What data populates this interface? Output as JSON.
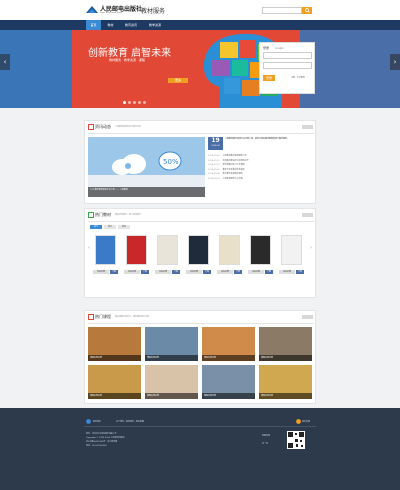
{
  "header": {
    "logo_cn": "人民邮电出版社",
    "logo_en": "Posts & Telecom Press",
    "site_name": "教材服务",
    "search_placeholder": ""
  },
  "nav": {
    "items": [
      "首页",
      "教材",
      "教育资讯",
      "教学资源"
    ]
  },
  "banner": {
    "title": "创新教育 启智未来",
    "subtitle": "教材服务 · 教学资源 · 课程",
    "button": "更多",
    "slide_count": 5,
    "active_slide": 1
  },
  "login": {
    "title": "登录",
    "hint": "/Login",
    "login_button": "登录",
    "register": "注册 · 忘记密码"
  },
  "news": {
    "title": "资讯动态",
    "subtitle": "人邮教育最新资讯与教学动态",
    "date_day": "19",
    "date_month": "2014-09",
    "caption": "TOP 教师课程资源平台上线  —— 人邮教育",
    "lead": "人邮教育教学资源平台全新上线，提供丰富的教材配套资源与教学服务。",
    "items": [
      {
        "date": "2014-09-16",
        "text": "人邮教育教材资源更新公告"
      },
      {
        "date": "2014-09-15",
        "text": "高校教材建设研讨会顺利召开"
      },
      {
        "date": "2014-09-12",
        "text": "新学期教材征订工作通知"
      },
      {
        "date": "2014-09-10",
        "text": "教师节优秀教材作者表彰"
      },
      {
        "date": "2014-09-08",
        "text": "数字教学资源使用指南"
      },
      {
        "date": "2014-09-05",
        "text": "人邮教育服务中心开通"
      }
    ]
  },
  "books": {
    "title": "热门教材",
    "subtitle": "精选优质教材，助力高效教学",
    "tabs": [
      "热门",
      "新书",
      "推荐"
    ],
    "items": [
      {
        "label": "书名示例",
        "action": "下载"
      },
      {
        "label": "书名示例",
        "action": "下载"
      },
      {
        "label": "书名示例",
        "action": "下载"
      },
      {
        "label": "书名示例",
        "action": "下载"
      },
      {
        "label": "书名示例",
        "action": "下载"
      },
      {
        "label": "书名示例",
        "action": "下载"
      },
      {
        "label": "书名示例",
        "action": "下载"
      }
    ]
  },
  "courses": {
    "title": "热门课程",
    "subtitle": "精品课程在线学习，随时随地提升自我",
    "items": [
      "课程名称示例",
      "课程名称示例",
      "课程名称示例",
      "课程名称示例",
      "课程名称示例",
      "课程名称示例",
      "课程名称示例",
      "课程名称示例"
    ]
  },
  "footer": {
    "links": "关于我们  |  联系我们  |  网站地图",
    "contact_title": "联系我们",
    "feedback": "意见反馈",
    "line1": "地址：北京市丰台区成寿寺路11号",
    "line2": "Copyright © 1999-2014 人民邮电出版社",
    "line3": "京ICP备05035396号 · 京公网安备",
    "line4": "电话：010-81055256",
    "qr_label": "扫一扫",
    "service": "客服热线"
  }
}
